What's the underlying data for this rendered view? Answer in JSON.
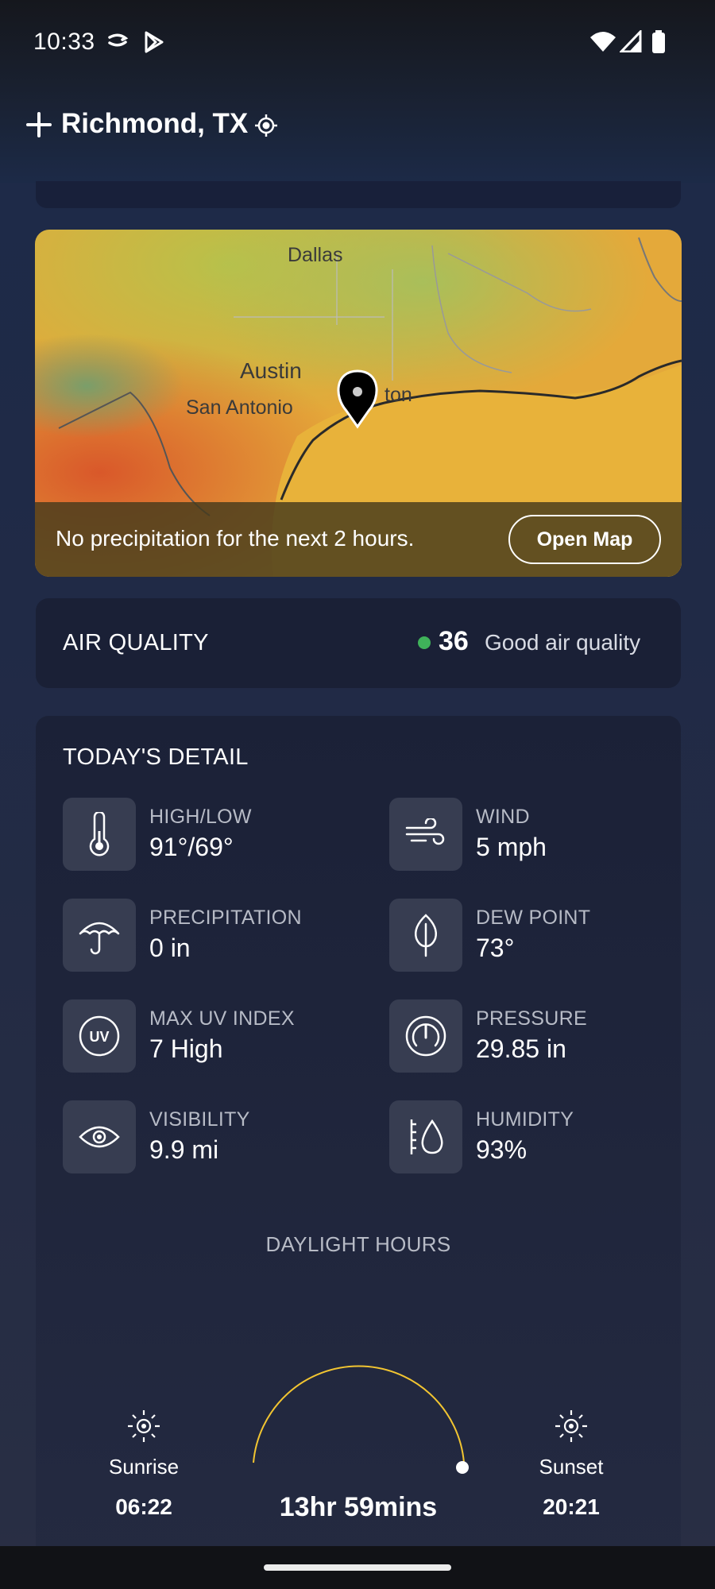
{
  "status_bar": {
    "time": "10:33",
    "icons": [
      "prime-arrow-icon",
      "play-store-icon",
      "wifi-icon",
      "signal-icon",
      "battery-icon"
    ]
  },
  "header": {
    "title": "Richmond, TX",
    "add_icon": "plus-icon",
    "location_icon": "crosshair-location-icon"
  },
  "map": {
    "labels": {
      "dallas": "Dallas",
      "austin": "Austin",
      "san_antonio": "San Antonio",
      "houston_partial": "ton"
    },
    "message": "No precipitation for the next 2 hours.",
    "open_map_label": "Open Map"
  },
  "air_quality": {
    "title": "AIR QUALITY",
    "value": "36",
    "description": "Good air quality",
    "status_color": "#3fb25a"
  },
  "todays_detail": {
    "title": "TODAY'S DETAIL",
    "items": [
      {
        "label": "HIGH/LOW",
        "value": "91°/69°",
        "icon": "thermometer-icon"
      },
      {
        "label": "WIND",
        "value": "5 mph",
        "icon": "wind-icon"
      },
      {
        "label": "PRECIPITATION",
        "value": "0 in",
        "icon": "umbrella-icon"
      },
      {
        "label": "DEW POINT",
        "value": "73°",
        "icon": "leaf-icon"
      },
      {
        "label": "MAX UV INDEX",
        "value": "7 High",
        "icon": "uv-icon"
      },
      {
        "label": "PRESSURE",
        "value": "29.85 in",
        "icon": "gauge-icon"
      },
      {
        "label": "VISIBILITY",
        "value": "9.9 mi",
        "icon": "eye-icon"
      },
      {
        "label": "HUMIDITY",
        "value": "93%",
        "icon": "humidity-icon"
      }
    ],
    "daylight": {
      "title": "DAYLIGHT HOURS",
      "sunrise_label": "Sunrise",
      "sunrise_time": "06:22",
      "sunset_label": "Sunset",
      "sunset_time": "20:21",
      "duration": "13hr 59mins",
      "arc_color": "#f2c531"
    }
  }
}
